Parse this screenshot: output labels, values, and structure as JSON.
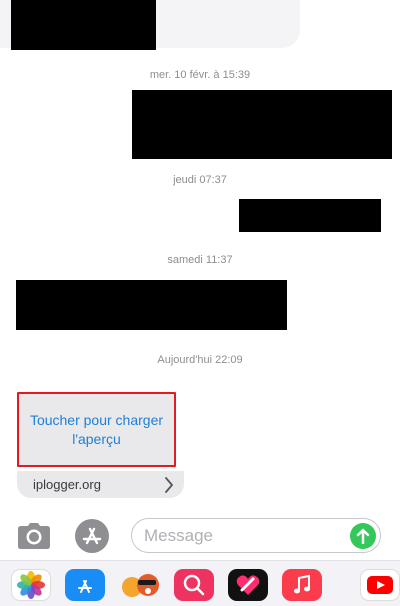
{
  "conversation": {
    "timestamps": [
      "mer. 10 févr. à 15:39",
      "jeudi 07:37",
      "samedi 11:37",
      "Aujourd'hui 22:09"
    ]
  },
  "link_preview": {
    "action_text": "Toucher pour charger l'aperçu",
    "domain": "iplogger.org",
    "highlight_color": "#e01b24",
    "action_color": "#1f7fd6"
  },
  "composer": {
    "placeholder": "Message",
    "camera_icon": "camera-icon",
    "appstore_icon": "app-store-icon",
    "send_icon": "arrow-up-icon",
    "send_color": "#34c759"
  },
  "app_tray": {
    "apps": [
      "photos",
      "app-store",
      "memoji",
      "search-images",
      "digital-touch",
      "music",
      "youtube"
    ]
  }
}
